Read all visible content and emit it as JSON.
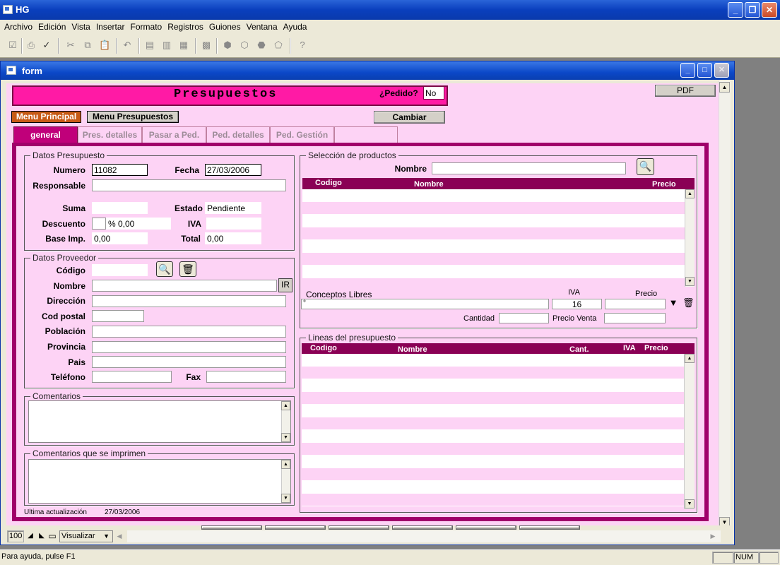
{
  "app": {
    "title": "HG"
  },
  "menubar": [
    "Archivo",
    "Edición",
    "Vista",
    "Insertar",
    "Formato",
    "Registros",
    "Guiones",
    "Ventana",
    "Ayuda"
  ],
  "child_window": {
    "title": "form"
  },
  "form": {
    "page_title": "Presupuestos",
    "pedido_label": "¿Pedido?",
    "pedido_value": "No",
    "pdf_label": "PDF",
    "menu_principal": "Menu Principal",
    "menu_presupuestos": "Menu Presupuestos",
    "cambiar": "Cambiar"
  },
  "tabs": [
    "general",
    "Pres. detalles",
    "Pasar a Ped.",
    "Ped. detalles",
    "Ped. Gestión"
  ],
  "datos_presupuesto": {
    "title": "Datos Presupuesto",
    "numero_label": "Numero",
    "numero": "11082",
    "fecha_label": "Fecha",
    "fecha": "27/03/2006",
    "responsable_label": "Responsable",
    "responsable": "",
    "suma_label": "Suma",
    "suma": "",
    "estado_label": "Estado",
    "estado": "Pendiente",
    "descuento_label": "Descuento",
    "descuento": "",
    "descuento_pct": "% 0,00",
    "iva_label": "IVA",
    "iva": "",
    "base_label": "Base Imp.",
    "base": "0,00",
    "total_label": "Total",
    "total": "0,00"
  },
  "datos_proveedor": {
    "title": "Datos Proveedor",
    "codigo_label": "Código",
    "nombre_label": "Nombre",
    "ir_label": "IR",
    "direccion_label": "Dirección",
    "cod_postal_label": "Cod postal",
    "poblacion_label": "Población",
    "provincia_label": "Provincia",
    "pais_label": "Pais",
    "telefono_label": "Teléfono",
    "fax_label": "Fax"
  },
  "comentarios": {
    "title": "Comentarios"
  },
  "comentarios_imprimen": {
    "title": "Comentarios que se imprimen"
  },
  "ultima": {
    "label": "Ultima actualización",
    "value": "27/03/2006"
  },
  "seleccion": {
    "title": "Selección de productos",
    "nombre_label": "Nombre",
    "columns": [
      "Codigo",
      "Nombre",
      "Precio"
    ]
  },
  "conceptos": {
    "title": "Conceptos Libres",
    "iva_label": "IVA",
    "precio_label": "Precio",
    "concepto_value": "°",
    "iva_value": "16",
    "cantidad_label": "Cantidad",
    "precio_venta_label": "Precio Venta"
  },
  "lineas": {
    "title": "Lineas del presupuesto",
    "columns": [
      "Codigo",
      "Nombre",
      "Cant.",
      "IVA",
      "Precio"
    ]
  },
  "bottom": {
    "zoom": "100",
    "mode": "Visualizar"
  },
  "status": {
    "help": "Para ayuda, pulse F1",
    "num": "NUM"
  },
  "colors": {
    "accent": "#ff1aa5",
    "panel": "#fdd3f5",
    "dark": "#8a0055"
  }
}
